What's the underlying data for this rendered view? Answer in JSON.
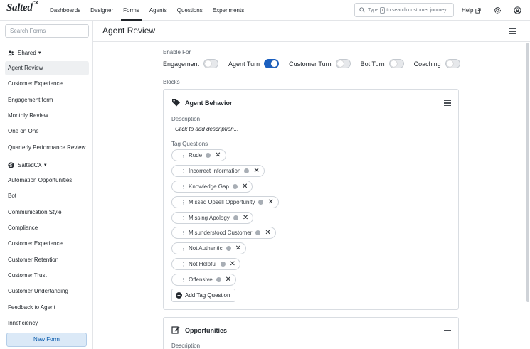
{
  "app": {
    "logo_text": "Salted",
    "logo_sup": "CX"
  },
  "nav": {
    "items": [
      {
        "label": "Dashboards"
      },
      {
        "label": "Designer"
      },
      {
        "label": "Forms"
      },
      {
        "label": "Agents"
      },
      {
        "label": "Questions"
      },
      {
        "label": "Experiments"
      }
    ],
    "active": "Forms",
    "search_prefix": "Type",
    "search_key": "/",
    "search_suffix": "to search customer journey",
    "help_label": "Help"
  },
  "sidebar": {
    "search_placeholder": "Search Forms",
    "groups": [
      {
        "label": "Shared",
        "items": [
          "Agent Review",
          "Customer Experience",
          "Engagement form",
          "Monthly Review",
          "One on One",
          "Quarterly Performance Review"
        ]
      },
      {
        "label": "SaltedCX",
        "items": [
          "Automation Opportunities",
          "Bot",
          "Communication Style",
          "Compliance",
          "Customer Experience",
          "Customer Retention",
          "Customer Trust",
          "Customer Undertanding",
          "Feedback to Agent",
          "Inneficiency"
        ]
      }
    ],
    "active_item": "Agent Review",
    "new_form_label": "New Form"
  },
  "main": {
    "title": "Agent Review",
    "enable_for_label": "Enable For",
    "toggles": [
      {
        "label": "Engagement",
        "on": false
      },
      {
        "label": "Agent Turn",
        "on": true
      },
      {
        "label": "Customer Turn",
        "on": false
      },
      {
        "label": "Bot Turn",
        "on": false
      },
      {
        "label": "Coaching",
        "on": false
      }
    ],
    "blocks_label": "Blocks",
    "blocks": [
      {
        "title": "Agent Behavior",
        "description_label": "Description",
        "description_value": "Click to add description...",
        "tag_questions_label": "Tag Questions",
        "tags": [
          "Rude",
          "Incorrect Information",
          "Knowledge Gap",
          "Missed Upsell Opportunity",
          "Missing Apology",
          "Misunderstood Customer",
          "Not Authentic",
          "Not Helpful",
          "Offensive"
        ],
        "add_tag_label": "Add Tag Question"
      },
      {
        "title": "Opportunities",
        "description_label": "Description"
      }
    ]
  }
}
